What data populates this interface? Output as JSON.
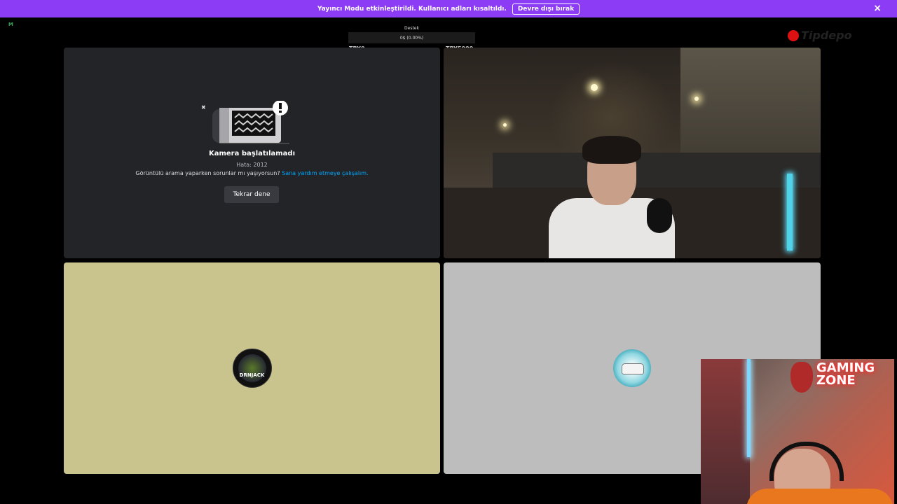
{
  "banner": {
    "message": "Yayıncı Modu etkinleştirildi. Kullanıcı adları kısaltıldı.",
    "disable_button": "Devre dışı bırak",
    "close_icon": "×",
    "background": "#8c3cf5"
  },
  "corner_badge": "M",
  "donation": {
    "title": "Destek",
    "progress_text": "0$ (0.00%)",
    "progress_fraction": 0.0,
    "min_label": "TRY0",
    "max_label": "TRY5000"
  },
  "brand": {
    "logo_text": "Tipdepo"
  },
  "tiles": {
    "camera_error": {
      "title": "Kamera başlatılamadı",
      "code": "Hata: 2012",
      "help_text": "Görüntülü arama yaparken sorunlar mı yaşıyorsun? ",
      "help_link": "Sana yardım etmeye çalışalım.",
      "retry_button": "Tekrar dene"
    },
    "avatar_a": {
      "label": "DRNJACK",
      "background": "#c9c48e"
    },
    "avatar_b": {
      "background": "#bdbdbd"
    }
  },
  "facecam": {
    "neon_line1": "GAMING",
    "neon_line2": "ZONE"
  }
}
